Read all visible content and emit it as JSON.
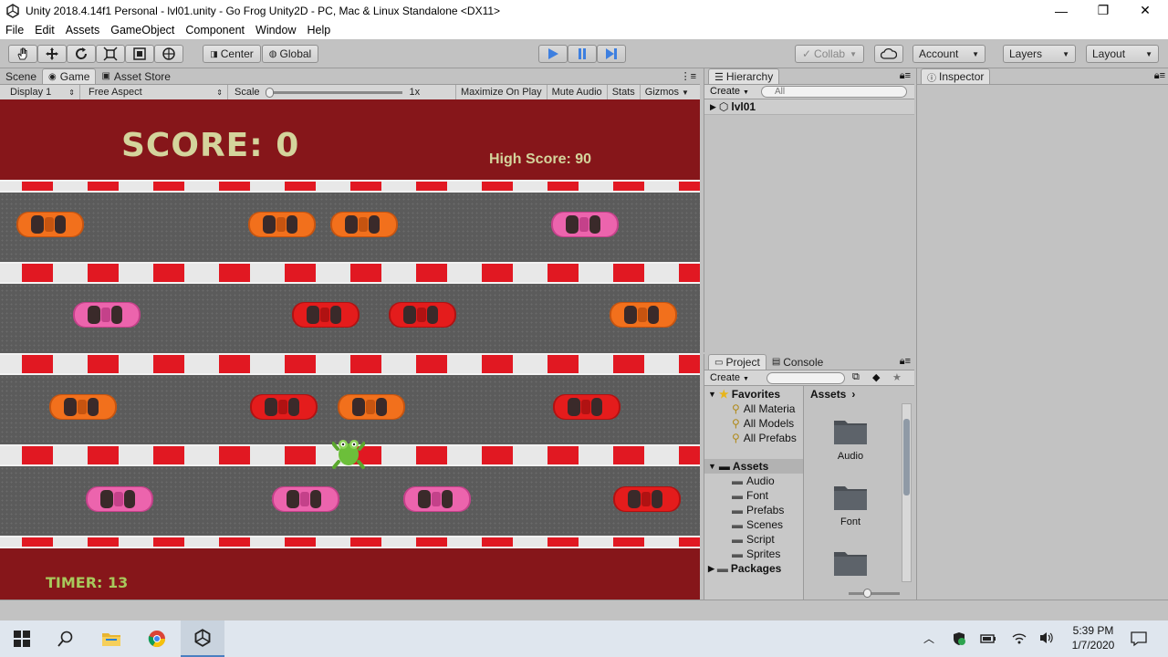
{
  "window": {
    "title": "Unity 2018.4.14f1 Personal - lvl01.unity - Go Frog Unity2D - PC, Mac & Linux Standalone <DX11>",
    "controls": [
      "—",
      "❐",
      "✕"
    ]
  },
  "menu": [
    "File",
    "Edit",
    "Assets",
    "GameObject",
    "Component",
    "Window",
    "Help"
  ],
  "toolbar": {
    "pivot": "Center",
    "space": "Global",
    "collab": "Collab",
    "account": "Account",
    "layers": "Layers",
    "layout": "Layout"
  },
  "scene_tabs": [
    "Scene",
    "Game",
    "Asset Store"
  ],
  "game_bar": {
    "display": "Display 1",
    "aspect": "Free Aspect",
    "scale_label": "Scale",
    "scale_value": "1x",
    "maximize": "Maximize On Play",
    "mute": "Mute Audio",
    "stats": "Stats",
    "gizmos": "Gizmos"
  },
  "game": {
    "score": "SCORE: 0",
    "high_score": "High Score: 90",
    "timer": "TIMER: 13",
    "colors": {
      "background": "#86161a",
      "road": "#5b5b5b",
      "stripe_red": "#e11822",
      "hud_text": "#d4d49c",
      "timer_text": "#a8c85c"
    }
  },
  "hierarchy": {
    "tab": "Hierarchy",
    "create": "Create",
    "search_placeholder": "All",
    "root": "lvl01"
  },
  "inspector": {
    "tab": "Inspector"
  },
  "project": {
    "tabs": [
      "Project",
      "Console"
    ],
    "create": "Create",
    "favorites_label": "Favorites",
    "favorites": [
      "All Materia",
      "All Models",
      "All Prefabs"
    ],
    "assets_label": "Assets",
    "asset_folders": [
      "Audio",
      "Font",
      "Prefabs",
      "Scenes",
      "Script",
      "Sprites"
    ],
    "packages_label": "Packages",
    "breadcrumb": "Assets",
    "grid_items": [
      "Audio",
      "Font"
    ]
  },
  "taskbar": {
    "time": "5:39 PM",
    "date": "1/7/2020"
  }
}
